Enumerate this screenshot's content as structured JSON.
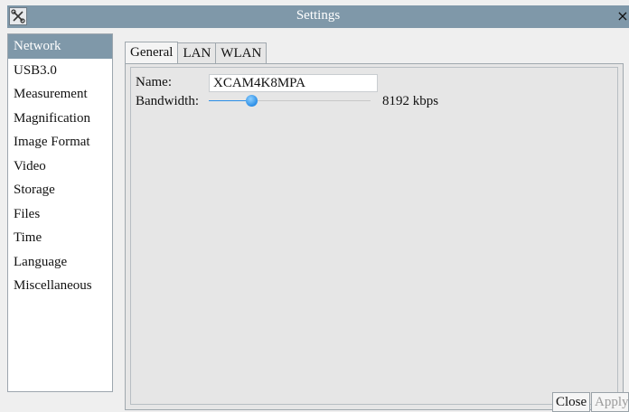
{
  "window": {
    "title": "Settings",
    "close_glyph": "×",
    "app_icon": "tools-icon"
  },
  "sidebar": {
    "items": [
      {
        "label": "Network",
        "selected": true
      },
      {
        "label": "USB3.0"
      },
      {
        "label": "Measurement"
      },
      {
        "label": "Magnification"
      },
      {
        "label": "Image Format"
      },
      {
        "label": "Video"
      },
      {
        "label": "Storage"
      },
      {
        "label": "Files"
      },
      {
        "label": "Time"
      },
      {
        "label": "Language"
      },
      {
        "label": "Miscellaneous"
      }
    ]
  },
  "tabs": [
    {
      "label": "General",
      "active": true
    },
    {
      "label": "LAN"
    },
    {
      "label": "WLAN"
    }
  ],
  "general": {
    "name_label": "Name:",
    "name_value": "XCAM4K8MPA",
    "bandwidth_label": "Bandwidth:",
    "bandwidth_value": "8192 kbps",
    "bandwidth_slider_fraction": 0.26
  },
  "buttons": {
    "close": "Close",
    "apply": "Apply"
  },
  "colors": {
    "accent": "#7f98a9",
    "slider": "#2a8de6"
  }
}
